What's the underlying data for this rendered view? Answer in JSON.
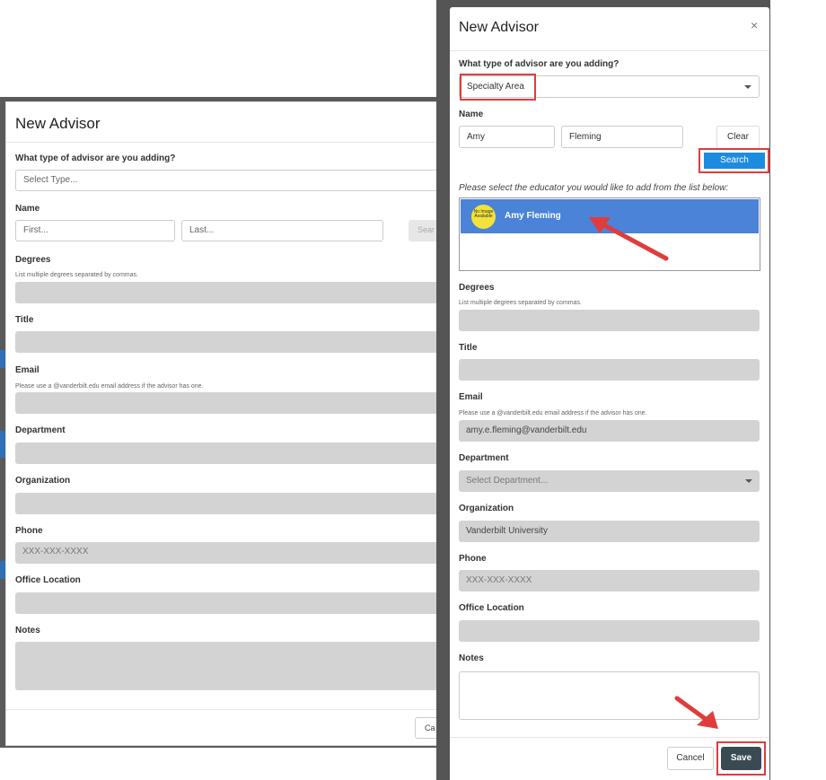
{
  "left_modal": {
    "title": "New Advisor",
    "type_question": "What type of advisor are you adding?",
    "type_placeholder": "Select Type...",
    "name_label": "Name",
    "first_placeholder": "First...",
    "last_placeholder": "Last...",
    "search_stub": "Sear",
    "degrees_label": "Degrees",
    "degrees_hint": "List multiple degrees separated by commas.",
    "title_label": "Title",
    "email_label": "Email",
    "email_hint": "Please use a @vanderbilt.edu email address if the advisor has one.",
    "department_label": "Department",
    "organization_label": "Organization",
    "phone_label": "Phone",
    "phone_placeholder": "XXX-XXX-XXXX",
    "office_label": "Office Location",
    "notes_label": "Notes",
    "cancel_stub": "Ca"
  },
  "right_modal": {
    "title": "New Advisor",
    "close": "×",
    "type_question": "What type of advisor are you adding?",
    "type_value": "Specialty Area",
    "name_label": "Name",
    "first_value": "Amy",
    "last_value": "Fleming",
    "clear_label": "Clear",
    "search_label": "Search",
    "pick_hint": "Please select the educator you would like to add from the list below:",
    "educator": {
      "name": "Amy Fleming",
      "avatar_text": "No Image Available"
    },
    "degrees_label": "Degrees",
    "degrees_hint": "List multiple degrees separated by commas.",
    "title_label": "Title",
    "email_label": "Email",
    "email_hint": "Please use a @vanderbilt.edu email address if the advisor has one.",
    "email_value": "amy.e.fleming@vanderbilt.edu",
    "department_label": "Department",
    "department_placeholder": "Select Department...",
    "organization_label": "Organization",
    "organization_value": "Vanderbilt University",
    "phone_label": "Phone",
    "phone_placeholder": "XXX-XXX-XXXX",
    "office_label": "Office Location",
    "notes_label": "Notes",
    "cancel_label": "Cancel",
    "save_label": "Save"
  },
  "colors": {
    "highlight_red": "#e03c3c",
    "search_blue": "#1d8ce0",
    "selected_row": "#4a83d8",
    "save_dark": "#3a4a52"
  }
}
